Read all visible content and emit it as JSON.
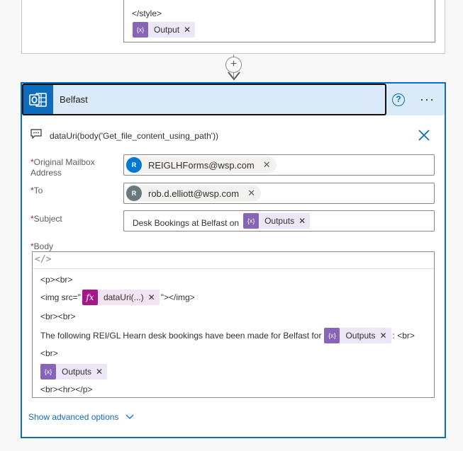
{
  "previous_step": {
    "style_close_text": "</style>",
    "output_token": {
      "label": "Output"
    }
  },
  "connector": {
    "plus_symbol": "+"
  },
  "card": {
    "title": "Belfast",
    "help_symbol": "?",
    "more_symbol": "···",
    "comment": "dataUri(body('Get_file_content_using_path'))"
  },
  "fields": {
    "mailbox": {
      "label_line1": "Original Mailbox",
      "label_line2": "Address",
      "required_mark": "*",
      "avatar_letter": "R",
      "value": "REIGLHForms@wsp.com"
    },
    "to": {
      "label": "To",
      "required_mark": "*",
      "avatar_letter": "R",
      "value": "rob.d.elliott@wsp.com"
    },
    "subject": {
      "label": "Subject",
      "required_mark": "*",
      "prefix": "Desk Bookings at Belfast on",
      "token": "Outputs"
    },
    "body": {
      "label": "Body",
      "required_mark": "*",
      "code_icon": "</>",
      "line1": "<p><br>",
      "line2_pre": "<img src=\"",
      "line2_token": "dataUri(...)",
      "line2_post": "\"></img>",
      "line3": "<br><br>",
      "line4_pre": "The following REI/GL Hearn desk bookings have been made for Belfast for",
      "line4_token": "Outputs",
      "line4_post": ": <br>",
      "line5": "<br>",
      "line6_token": "Outputs",
      "line7": "<br><hr></p>"
    }
  },
  "advanced": {
    "label": "Show advanced options"
  },
  "colors": {
    "accent": "#0f6cbd",
    "token_purple": "#8764b8",
    "token_magenta": "#a4188a",
    "avatar_blue": "#0078d4",
    "avatar_gray": "#69797e"
  }
}
